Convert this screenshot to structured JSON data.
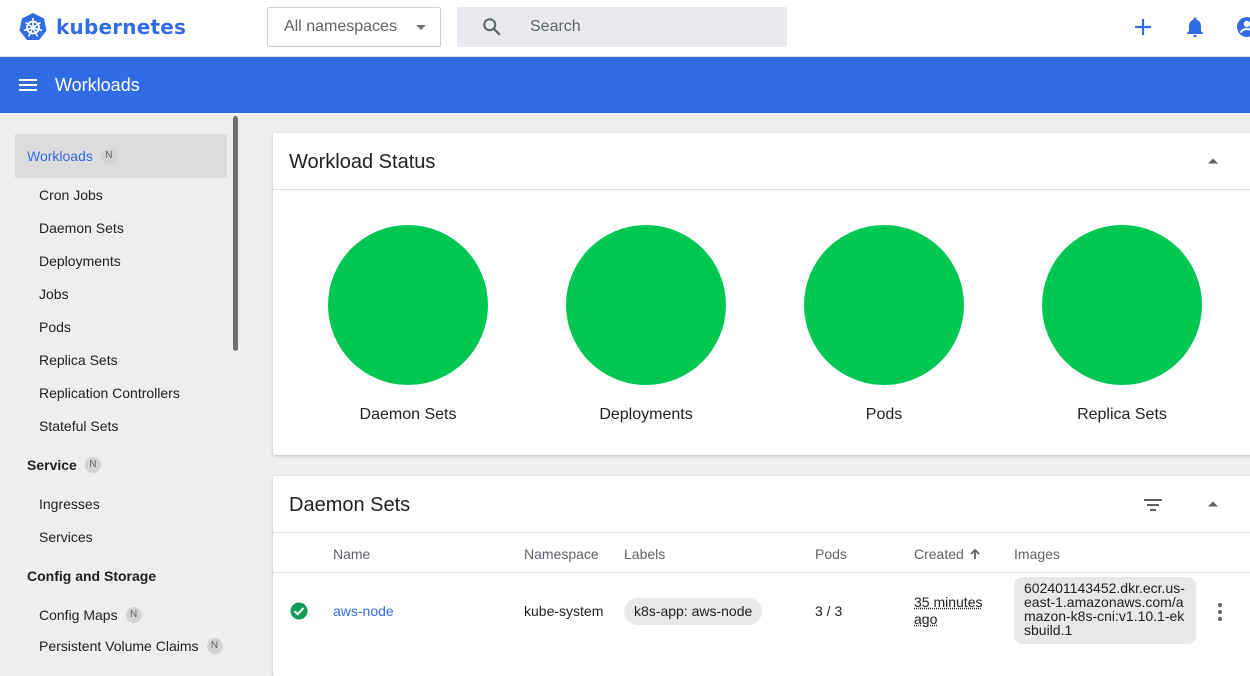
{
  "colors": {
    "brand": "#326ce5",
    "status_ok": "#00c752"
  },
  "topbar": {
    "logo_text": "kubernetes",
    "namespace_select": "All namespaces",
    "search_placeholder": "Search",
    "icons": [
      "add-icon",
      "notifications-icon",
      "account-icon"
    ]
  },
  "appbar": {
    "title": "Workloads"
  },
  "sidebar": {
    "workloads": {
      "label": "Workloads",
      "badge": "N"
    },
    "workload_items": [
      "Cron Jobs",
      "Daemon Sets",
      "Deployments",
      "Jobs",
      "Pods",
      "Replica Sets",
      "Replication Controllers",
      "Stateful Sets"
    ],
    "service": {
      "label": "Service",
      "badge": "N"
    },
    "service_items": [
      "Ingresses",
      "Services"
    ],
    "config": {
      "label": "Config and Storage"
    },
    "config_items": [
      {
        "label": "Config Maps",
        "badge": "N"
      },
      {
        "label": "Persistent Volume Claims",
        "badge": "N"
      }
    ]
  },
  "workload_status": {
    "title": "Workload Status",
    "items": [
      {
        "label": "Daemon Sets",
        "running_fraction": 1.0
      },
      {
        "label": "Deployments",
        "running_fraction": 1.0
      },
      {
        "label": "Pods",
        "running_fraction": 1.0
      },
      {
        "label": "Replica Sets",
        "running_fraction": 1.0
      }
    ]
  },
  "daemon_sets": {
    "title": "Daemon Sets",
    "columns": {
      "name": "Name",
      "namespace": "Namespace",
      "labels": "Labels",
      "pods": "Pods",
      "created": "Created",
      "images": "Images"
    },
    "sort_column": "created",
    "rows": [
      {
        "status": "check-circle-icon",
        "name": "aws-node",
        "namespace": "kube-system",
        "label": "k8s-app: aws-node",
        "pods": "3 / 3",
        "created": "35 minutes ago",
        "image": "602401143452.dkr.ecr.us-east-1.amazonaws.com/amazon-k8s-cni:v1.10.1-eksbuild.1"
      }
    ]
  }
}
